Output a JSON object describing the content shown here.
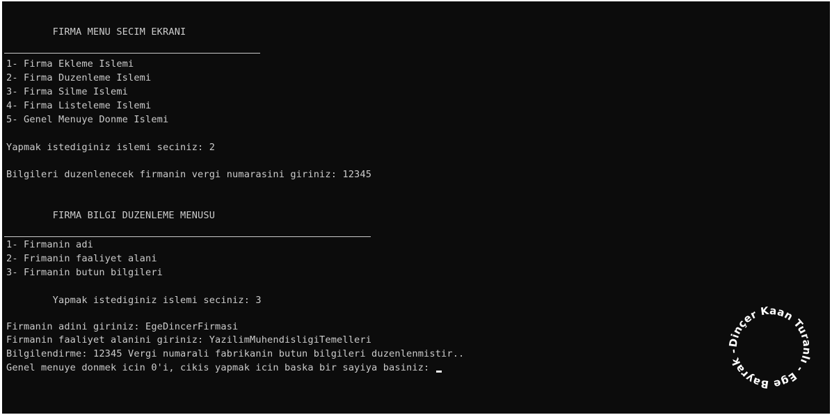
{
  "console": {
    "menu1_title": "        FIRMA MENU SECIM EKRANI",
    "menu1_items": [
      "1- Firma Ekleme Islemi",
      "2- Firma Duzenleme Islemi",
      "3- Firma Silme Islemi",
      "4- Firma Listeleme Islemi",
      "5- Genel Menuye Donme Islemi"
    ],
    "prompt_choice_1": "Yapmak istediginiz islemi seciniz: 2",
    "prompt_tax_number": "Bilgileri duzenlenecek firmanin vergi numarasini giriniz: 12345",
    "menu2_title": "        FIRMA BILGI DUZENLEME MENUSU",
    "menu2_items": [
      "1- Firmanin adi",
      "2- Frimanin faaliyet alani",
      "3- Firmanin butun bilgileri"
    ],
    "prompt_choice_2": "        Yapmak istediginiz islemi seciniz: 3",
    "input_name": "Firmanin adini giriniz: EgeDincerFirmasi",
    "input_activity": "Firmanin faaliyet alanini giriniz: YazilimMuhendisligiTemelleri",
    "info_message": "Bilgilendirme: 12345 Vergi numarali fabrikanin butun bilgileri duzenlenmistir..",
    "final_prompt": "Genel menuye donmek icin 0'i, cikis yapmak icin baska bir sayiya basiniz: "
  },
  "watermark": {
    "text": "Dinçer Kaan Turanlı - Ege Bayrak - ",
    "color": "#ffffff"
  },
  "colors": {
    "background": "#0c0c0c",
    "text": "#cccccc"
  }
}
